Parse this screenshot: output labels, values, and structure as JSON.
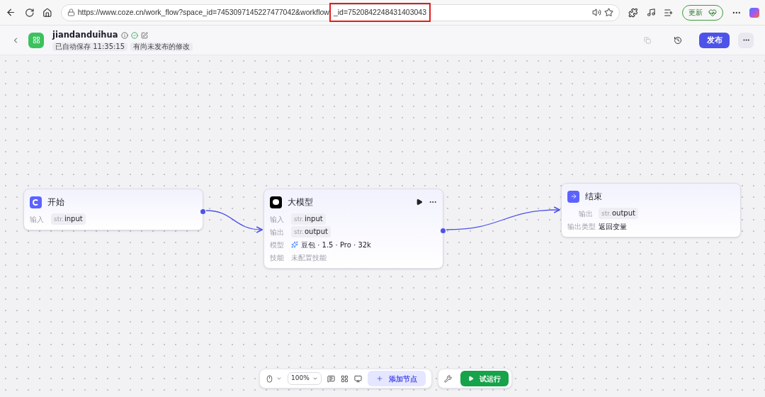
{
  "browser": {
    "url": "https://www.coze.cn/work_flow?space_id=7453097145227477042&workflow",
    "url_highlighted": "_id=7520842248431403043",
    "update_label": "更新"
  },
  "header": {
    "title": "jiandanduihua",
    "saved": "已自动保存 11:35:15",
    "unpublished": "有尚未发布的修改",
    "publish": "发布"
  },
  "nodes": [
    {
      "kind": "start",
      "title": "开始",
      "running_controls": false,
      "rows": [
        {
          "kind": "var",
          "label": "输入",
          "tag": "str.",
          "value": "input"
        }
      ]
    },
    {
      "kind": "llm",
      "title": "大模型",
      "running_controls": true,
      "rows": [
        {
          "kind": "var",
          "label": "输入",
          "tag": "str.",
          "value": "input"
        },
        {
          "kind": "var",
          "label": "输出",
          "tag": "str.",
          "value": "output"
        },
        {
          "kind": "model",
          "label": "模型",
          "value": "豆包 · 1.5 · Pro · 32k"
        },
        {
          "kind": "empty",
          "label": "技能",
          "value": "未配置技能"
        }
      ]
    },
    {
      "kind": "end",
      "title": "结束",
      "running_controls": false,
      "rows": [
        {
          "kind": "var",
          "label": "输出",
          "tag": "str.",
          "value": "output"
        },
        {
          "kind": "text",
          "label": "输出类型",
          "value": "返回变量"
        }
      ]
    }
  ],
  "toolbar": {
    "zoom": "100%",
    "add_node": "添加节点",
    "test_run": "试运行"
  }
}
